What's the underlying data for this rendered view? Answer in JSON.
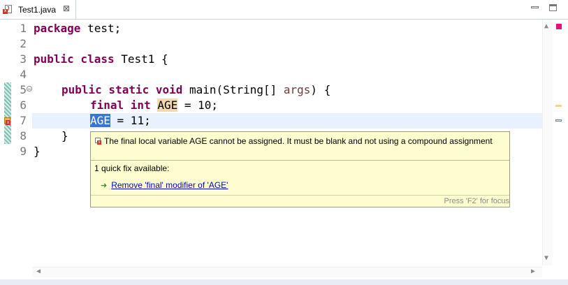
{
  "tab": {
    "label": "Test1.java",
    "close_glyph": "⊠"
  },
  "window": {
    "minimize_icon": "minimize-icon",
    "maximize_icon": "maximize-icon"
  },
  "code": {
    "line_numbers": [
      "1",
      "2",
      "3",
      "4",
      "5",
      "6",
      "7",
      "8",
      "9"
    ],
    "lines": {
      "l1_kw": "package",
      "l1_rest": " test;",
      "l3_kw": "public class",
      "l3_rest": " Test1 {",
      "l5_kw": "public static void",
      "l5_rest": " main(String[] ",
      "l5_param": "args",
      "l5_end": ") {",
      "l6_kw": "final int",
      "l6_var": "AGE",
      "l6_rest": " = 10;",
      "l7_var": "AGE",
      "l7_rest": " = 11;",
      "l8": "}",
      "l9": "}"
    }
  },
  "popup": {
    "message": "The final local variable AGE cannot be assigned. It must be blank and not using a compound assignment",
    "count": "1 quick fix available:",
    "fix": "Remove 'final' modifier of 'AGE'",
    "hint": "Press 'F2' for focus"
  },
  "colors": {
    "keyword": "#7f0055",
    "selection": "#3875d7",
    "current_line": "#e8f2fe",
    "popup_bg": "#fdfdd0"
  }
}
